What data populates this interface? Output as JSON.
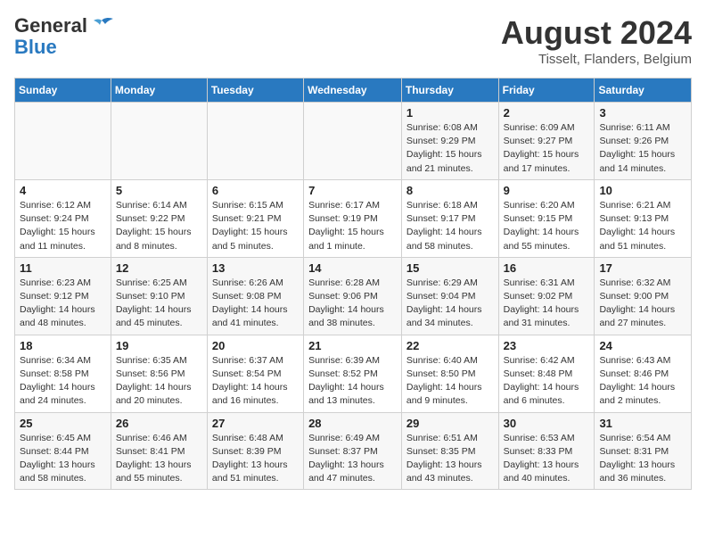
{
  "header": {
    "logo_general": "General",
    "logo_blue": "Blue",
    "month_title": "August 2024",
    "location": "Tisselt, Flanders, Belgium"
  },
  "weekdays": [
    "Sunday",
    "Monday",
    "Tuesday",
    "Wednesday",
    "Thursday",
    "Friday",
    "Saturday"
  ],
  "weeks": [
    [
      {
        "day": "",
        "info": ""
      },
      {
        "day": "",
        "info": ""
      },
      {
        "day": "",
        "info": ""
      },
      {
        "day": "",
        "info": ""
      },
      {
        "day": "1",
        "info": "Sunrise: 6:08 AM\nSunset: 9:29 PM\nDaylight: 15 hours\nand 21 minutes."
      },
      {
        "day": "2",
        "info": "Sunrise: 6:09 AM\nSunset: 9:27 PM\nDaylight: 15 hours\nand 17 minutes."
      },
      {
        "day": "3",
        "info": "Sunrise: 6:11 AM\nSunset: 9:26 PM\nDaylight: 15 hours\nand 14 minutes."
      }
    ],
    [
      {
        "day": "4",
        "info": "Sunrise: 6:12 AM\nSunset: 9:24 PM\nDaylight: 15 hours\nand 11 minutes."
      },
      {
        "day": "5",
        "info": "Sunrise: 6:14 AM\nSunset: 9:22 PM\nDaylight: 15 hours\nand 8 minutes."
      },
      {
        "day": "6",
        "info": "Sunrise: 6:15 AM\nSunset: 9:21 PM\nDaylight: 15 hours\nand 5 minutes."
      },
      {
        "day": "7",
        "info": "Sunrise: 6:17 AM\nSunset: 9:19 PM\nDaylight: 15 hours\nand 1 minute."
      },
      {
        "day": "8",
        "info": "Sunrise: 6:18 AM\nSunset: 9:17 PM\nDaylight: 14 hours\nand 58 minutes."
      },
      {
        "day": "9",
        "info": "Sunrise: 6:20 AM\nSunset: 9:15 PM\nDaylight: 14 hours\nand 55 minutes."
      },
      {
        "day": "10",
        "info": "Sunrise: 6:21 AM\nSunset: 9:13 PM\nDaylight: 14 hours\nand 51 minutes."
      }
    ],
    [
      {
        "day": "11",
        "info": "Sunrise: 6:23 AM\nSunset: 9:12 PM\nDaylight: 14 hours\nand 48 minutes."
      },
      {
        "day": "12",
        "info": "Sunrise: 6:25 AM\nSunset: 9:10 PM\nDaylight: 14 hours\nand 45 minutes."
      },
      {
        "day": "13",
        "info": "Sunrise: 6:26 AM\nSunset: 9:08 PM\nDaylight: 14 hours\nand 41 minutes."
      },
      {
        "day": "14",
        "info": "Sunrise: 6:28 AM\nSunset: 9:06 PM\nDaylight: 14 hours\nand 38 minutes."
      },
      {
        "day": "15",
        "info": "Sunrise: 6:29 AM\nSunset: 9:04 PM\nDaylight: 14 hours\nand 34 minutes."
      },
      {
        "day": "16",
        "info": "Sunrise: 6:31 AM\nSunset: 9:02 PM\nDaylight: 14 hours\nand 31 minutes."
      },
      {
        "day": "17",
        "info": "Sunrise: 6:32 AM\nSunset: 9:00 PM\nDaylight: 14 hours\nand 27 minutes."
      }
    ],
    [
      {
        "day": "18",
        "info": "Sunrise: 6:34 AM\nSunset: 8:58 PM\nDaylight: 14 hours\nand 24 minutes."
      },
      {
        "day": "19",
        "info": "Sunrise: 6:35 AM\nSunset: 8:56 PM\nDaylight: 14 hours\nand 20 minutes."
      },
      {
        "day": "20",
        "info": "Sunrise: 6:37 AM\nSunset: 8:54 PM\nDaylight: 14 hours\nand 16 minutes."
      },
      {
        "day": "21",
        "info": "Sunrise: 6:39 AM\nSunset: 8:52 PM\nDaylight: 14 hours\nand 13 minutes."
      },
      {
        "day": "22",
        "info": "Sunrise: 6:40 AM\nSunset: 8:50 PM\nDaylight: 14 hours\nand 9 minutes."
      },
      {
        "day": "23",
        "info": "Sunrise: 6:42 AM\nSunset: 8:48 PM\nDaylight: 14 hours\nand 6 minutes."
      },
      {
        "day": "24",
        "info": "Sunrise: 6:43 AM\nSunset: 8:46 PM\nDaylight: 14 hours\nand 2 minutes."
      }
    ],
    [
      {
        "day": "25",
        "info": "Sunrise: 6:45 AM\nSunset: 8:44 PM\nDaylight: 13 hours\nand 58 minutes."
      },
      {
        "day": "26",
        "info": "Sunrise: 6:46 AM\nSunset: 8:41 PM\nDaylight: 13 hours\nand 55 minutes."
      },
      {
        "day": "27",
        "info": "Sunrise: 6:48 AM\nSunset: 8:39 PM\nDaylight: 13 hours\nand 51 minutes."
      },
      {
        "day": "28",
        "info": "Sunrise: 6:49 AM\nSunset: 8:37 PM\nDaylight: 13 hours\nand 47 minutes."
      },
      {
        "day": "29",
        "info": "Sunrise: 6:51 AM\nSunset: 8:35 PM\nDaylight: 13 hours\nand 43 minutes."
      },
      {
        "day": "30",
        "info": "Sunrise: 6:53 AM\nSunset: 8:33 PM\nDaylight: 13 hours\nand 40 minutes."
      },
      {
        "day": "31",
        "info": "Sunrise: 6:54 AM\nSunset: 8:31 PM\nDaylight: 13 hours\nand 36 minutes."
      }
    ]
  ]
}
